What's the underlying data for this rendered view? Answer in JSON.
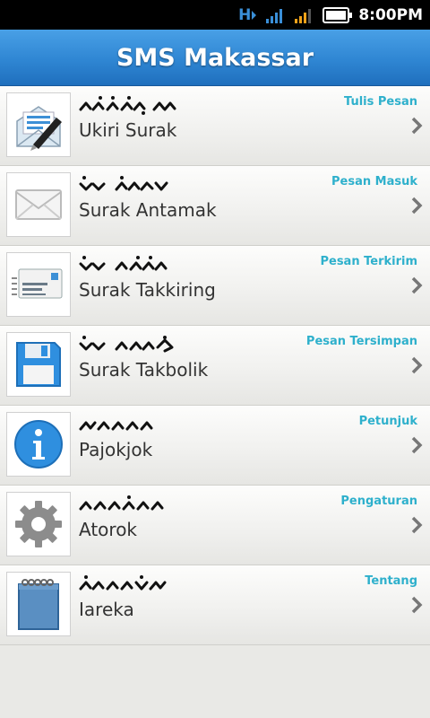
{
  "status": {
    "time": "8:00PM",
    "network": "H"
  },
  "app": {
    "title": "SMS Makassar"
  },
  "menu": [
    {
      "lontara_strokes": [
        [
          "low-left",
          "peak",
          "peak",
          "peak-dot",
          "gap",
          "peak",
          "loop"
        ]
      ],
      "label": "Ukiri Surak",
      "sublabel": "Tulis Pesan",
      "icon": "compose-envelope-pen-icon"
    },
    {
      "label": "Surak Antamak",
      "sublabel": "Pesan Masuk",
      "icon": "envelope-icon"
    },
    {
      "label": "Surak Takkiring",
      "sublabel": "Pesan Terkirim",
      "icon": "sent-letter-icon"
    },
    {
      "label": "Surak Takbolik",
      "sublabel": "Pesan Tersimpan",
      "icon": "floppy-disk-icon"
    },
    {
      "label": "Pajokjok",
      "sublabel": "Petunjuk",
      "icon": "info-icon"
    },
    {
      "label": "Atorok",
      "sublabel": "Pengaturan",
      "icon": "gear-icon"
    },
    {
      "label": "Iareka",
      "sublabel": "Tentang",
      "icon": "notepad-icon"
    }
  ],
  "colors": {
    "accent": "#2eb0cc",
    "titlebar": "#2f86d3",
    "background": "#e9e9e6"
  }
}
